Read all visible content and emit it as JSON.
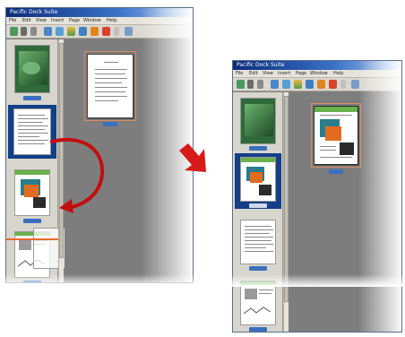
{
  "left_window": {
    "title": "Pacific Dock Suite",
    "menu": [
      "File",
      "Edit",
      "View",
      "Insert",
      "Page",
      "Window",
      "Help"
    ]
  },
  "right_window": {
    "title": "Pacific Dock Suite",
    "menu": [
      "File",
      "Edit",
      "View",
      "Insert",
      "Page",
      "Window",
      "Help"
    ]
  },
  "colors": {
    "selection": "#123f86",
    "drag_arrow": "#c40d0d",
    "transition_arrow": "#d61a1a",
    "workspace": "#7d7d7d"
  },
  "icons": [
    "undo-icon",
    "redo-icon",
    "copy-icon",
    "paste-icon",
    "new-page-icon",
    "image-icon",
    "cut-icon",
    "color-icon",
    "heart-icon",
    "help-icon"
  ]
}
